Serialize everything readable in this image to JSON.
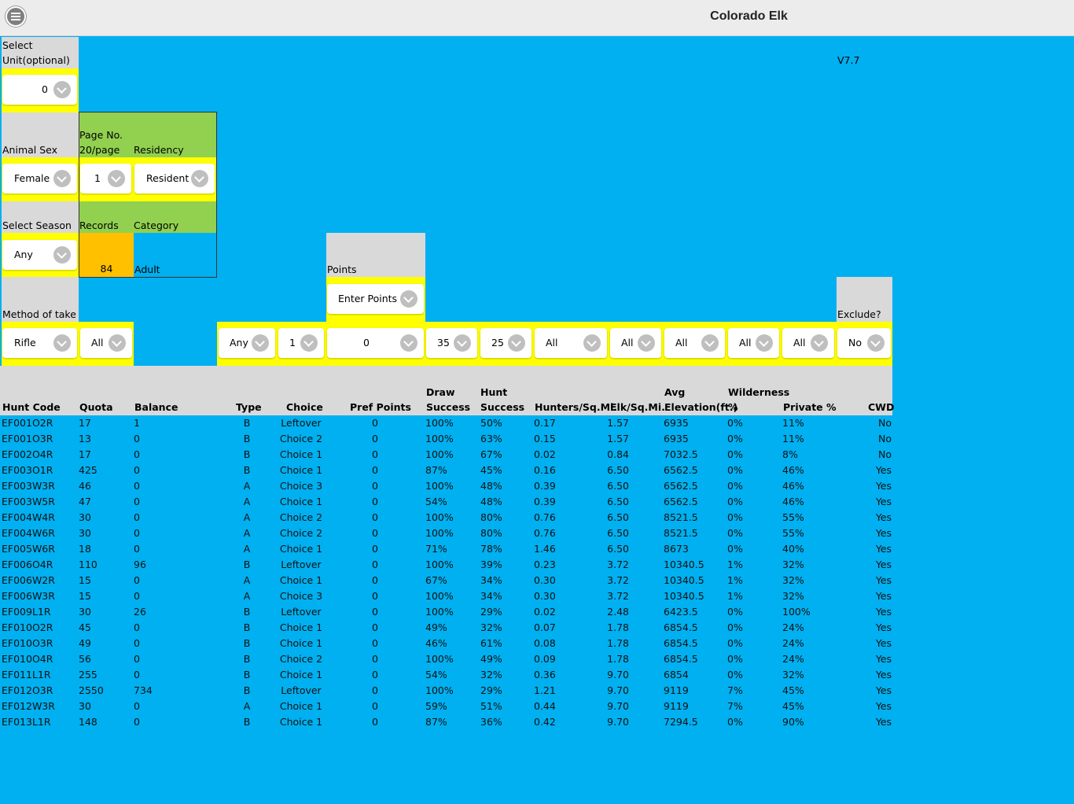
{
  "app": {
    "title": "Colorado Elk",
    "version": "V7.7",
    "menu_icon": "hamburger-menu-icon"
  },
  "filters": {
    "unit": {
      "label": "Select Unit(optional)",
      "value": "0"
    },
    "animal_sex": {
      "label": "Animal Sex",
      "value": "Female"
    },
    "page_no": {
      "label": "Page No. 20/page",
      "value": "1"
    },
    "residency": {
      "label": "Residency",
      "value": "Resident"
    },
    "season": {
      "label": "Select Season",
      "value": "Any"
    },
    "records": {
      "label": "Records",
      "value": "84"
    },
    "category": {
      "label": "Category",
      "value": "Adult"
    },
    "points": {
      "label": "Points",
      "value": "Enter Points"
    },
    "method_of_take": {
      "label": "Method of take",
      "value": "Rifle"
    },
    "method_sub": {
      "value": "All"
    },
    "exclude": {
      "label": "Exclude?",
      "value": "No"
    },
    "column_filters": {
      "type": "Any",
      "choice": "1",
      "pref_points": "0",
      "draw_success": "35",
      "hunt_success": "25",
      "hunters_sqmi": "All",
      "elk_sqmi": "All",
      "avg_elevation": "All",
      "wilderness": "All",
      "private": "All"
    }
  },
  "table": {
    "headers": {
      "hunt_code": "Hunt Code",
      "quota": "Quota",
      "balance": "Balance",
      "type": "Type",
      "choice": "Choice",
      "pref_points": "Pref Points",
      "draw_success_1": "Draw",
      "draw_success_2": "Success",
      "hunt_success_1": "Hunt",
      "hunt_success_2": "Success",
      "hunters_sqmi": "Hunters/Sq.Mi.",
      "elk_sqmi": "Elk/Sq.Mi.",
      "avg_elev_1": "Avg",
      "avg_elev_2": "Elevation(ft.)",
      "wilderness_1": "Wilderness",
      "wilderness_2": "%",
      "private": "Private %",
      "cwd": "CWD"
    },
    "rows": [
      [
        "EF001O2R",
        "17",
        "1",
        "B",
        "Leftover",
        "0",
        "100%",
        "50%",
        "0.17",
        "1.57",
        "6935",
        "0%",
        "11%",
        "No"
      ],
      [
        "EF001O3R",
        "13",
        "0",
        "B",
        "Choice 2",
        "0",
        "100%",
        "63%",
        "0.15",
        "1.57",
        "6935",
        "0%",
        "11%",
        "No"
      ],
      [
        "EF002O4R",
        "17",
        "0",
        "B",
        "Choice 1",
        "0",
        "100%",
        "67%",
        "0.02",
        "0.84",
        "7032.5",
        "0%",
        "8%",
        "No"
      ],
      [
        "EF003O1R",
        "425",
        "0",
        "B",
        "Choice 1",
        "0",
        "87%",
        "45%",
        "0.16",
        "6.50",
        "6562.5",
        "0%",
        "46%",
        "Yes"
      ],
      [
        "EF003W3R",
        "46",
        "0",
        "A",
        "Choice 3",
        "0",
        "100%",
        "48%",
        "0.39",
        "6.50",
        "6562.5",
        "0%",
        "46%",
        "Yes"
      ],
      [
        "EF003W5R",
        "47",
        "0",
        "A",
        "Choice 1",
        "0",
        "54%",
        "48%",
        "0.39",
        "6.50",
        "6562.5",
        "0%",
        "46%",
        "Yes"
      ],
      [
        "EF004W4R",
        "30",
        "0",
        "A",
        "Choice 2",
        "0",
        "100%",
        "80%",
        "0.76",
        "6.50",
        "8521.5",
        "0%",
        "55%",
        "Yes"
      ],
      [
        "EF004W6R",
        "30",
        "0",
        "A",
        "Choice 2",
        "0",
        "100%",
        "80%",
        "0.76",
        "6.50",
        "8521.5",
        "0%",
        "55%",
        "Yes"
      ],
      [
        "EF005W6R",
        "18",
        "0",
        "A",
        "Choice 1",
        "0",
        "71%",
        "78%",
        "1.46",
        "6.50",
        "8673",
        "0%",
        "40%",
        "Yes"
      ],
      [
        "EF006O4R",
        "110",
        "96",
        "B",
        "Leftover",
        "0",
        "100%",
        "39%",
        "0.23",
        "3.72",
        "10340.5",
        "1%",
        "32%",
        "Yes"
      ],
      [
        "EF006W2R",
        "15",
        "0",
        "A",
        "Choice 1",
        "0",
        "67%",
        "34%",
        "0.30",
        "3.72",
        "10340.5",
        "1%",
        "32%",
        "Yes"
      ],
      [
        "EF006W3R",
        "15",
        "0",
        "A",
        "Choice 3",
        "0",
        "100%",
        "34%",
        "0.30",
        "3.72",
        "10340.5",
        "1%",
        "32%",
        "Yes"
      ],
      [
        "EF009L1R",
        "30",
        "26",
        "B",
        "Leftover",
        "0",
        "100%",
        "29%",
        "0.02",
        "2.48",
        "6423.5",
        "0%",
        "100%",
        "Yes"
      ],
      [
        "EF010O2R",
        "45",
        "0",
        "B",
        "Choice 1",
        "0",
        "49%",
        "32%",
        "0.07",
        "1.78",
        "6854.5",
        "0%",
        "24%",
        "Yes"
      ],
      [
        "EF010O3R",
        "49",
        "0",
        "B",
        "Choice 1",
        "0",
        "46%",
        "61%",
        "0.08",
        "1.78",
        "6854.5",
        "0%",
        "24%",
        "Yes"
      ],
      [
        "EF010O4R",
        "56",
        "0",
        "B",
        "Choice 2",
        "0",
        "100%",
        "49%",
        "0.09",
        "1.78",
        "6854.5",
        "0%",
        "24%",
        "Yes"
      ],
      [
        "EF011L1R",
        "255",
        "0",
        "B",
        "Choice 1",
        "0",
        "54%",
        "32%",
        "0.36",
        "9.70",
        "6854",
        "0%",
        "32%",
        "Yes"
      ],
      [
        "EF012O3R",
        "2550",
        "734",
        "B",
        "Leftover",
        "0",
        "100%",
        "29%",
        "1.21",
        "9.70",
        "9119",
        "7%",
        "45%",
        "Yes"
      ],
      [
        "EF012W3R",
        "30",
        "0",
        "A",
        "Choice 1",
        "0",
        "59%",
        "51%",
        "0.44",
        "9.70",
        "9119",
        "7%",
        "45%",
        "Yes"
      ],
      [
        "EF013L1R",
        "148",
        "0",
        "B",
        "Choice 1",
        "0",
        "87%",
        "36%",
        "0.42",
        "9.70",
        "7294.5",
        "0%",
        "90%",
        "Yes"
      ]
    ]
  }
}
